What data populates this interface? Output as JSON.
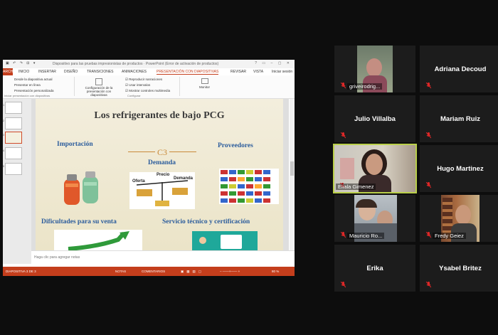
{
  "powerpoint": {
    "quick_access": "▣ ↶ ↷ ⊟ ▾",
    "title_text": "Dispositivo para las pruebas impresionistas de productos · PowerPoint (Error de activación de productos)",
    "window_controls": "? ▭ – ▢ ✕",
    "tabs": {
      "file": "ARCHIVO",
      "items": [
        "INICIO",
        "INSERTAR",
        "DISEÑO",
        "TRANSICIONES",
        "ANIMACIONES",
        "PRESENTACIÓN CON DIAPOSITIVAS",
        "REVISAR",
        "VISTA"
      ],
      "account": "Iniciar sesión"
    },
    "ribbon": {
      "btn1": "Desde la diapositiva actual",
      "btn2": "Presentar en línea",
      "btn3": "Presentación personalizada",
      "btn_config": "Configuración de la presentación con diapositivas",
      "chk1": "Reproducir narraciones",
      "chk2": "Usar intervalos",
      "chk3": "Mostrar controles multimedia",
      "monitor": "Monitor",
      "group1": "Iniciar presentación con diapositivas",
      "group2": "Configurar"
    },
    "slide": {
      "title": "Los refrigerantes de bajo PCG",
      "importacion": "Importación",
      "proveedores": "Proveedores",
      "demanda": "Demanda",
      "ornament": "C3",
      "dificultades": "Dificultades para su venta",
      "servicio": "Servicio técnico y certificación",
      "diagram": {
        "oferta": "Oferta",
        "precio": "Precio",
        "demanda": "Demanda"
      }
    },
    "notes_placeholder": "Haga clic para agregar notas",
    "status": {
      "slide": "DIAPOSITIVA 3 DE 3",
      "notes": "NOTAS",
      "comments": "COMENTARIOS",
      "zoom": "80 %"
    },
    "thumb_numbers": [
      "1",
      "2",
      "3",
      "4",
      "5"
    ]
  },
  "participants": [
    {
      "name": "griveirodrig...",
      "has_video": true
    },
    {
      "name": "Adriana Decoud",
      "has_video": false
    },
    {
      "name": "Julio Villalba",
      "has_video": false
    },
    {
      "name": "Mariam Ruiz",
      "has_video": false
    },
    {
      "name": "Eliala Gimenez",
      "has_video": true,
      "active_speaker": true
    },
    {
      "name": "Hugo Martinez",
      "has_video": false
    },
    {
      "name": "Mauricio Ro...",
      "has_video": true
    },
    {
      "name": "Fredy Geiez",
      "has_video": true
    },
    {
      "name": "Erika",
      "has_video": false
    },
    {
      "name": "Ysabel Britez",
      "has_video": false
    }
  ],
  "colors": {
    "meeting_bg": "#0d0d0d",
    "tile_bg": "#1c1c1c",
    "active_speaker": "#b9cf4a",
    "muted_mic": "#e02828",
    "ppt_accent": "#c43e1c",
    "slide_title_blue": "#2b5c9c"
  },
  "icons": {
    "muted": "mic-muted-icon"
  }
}
